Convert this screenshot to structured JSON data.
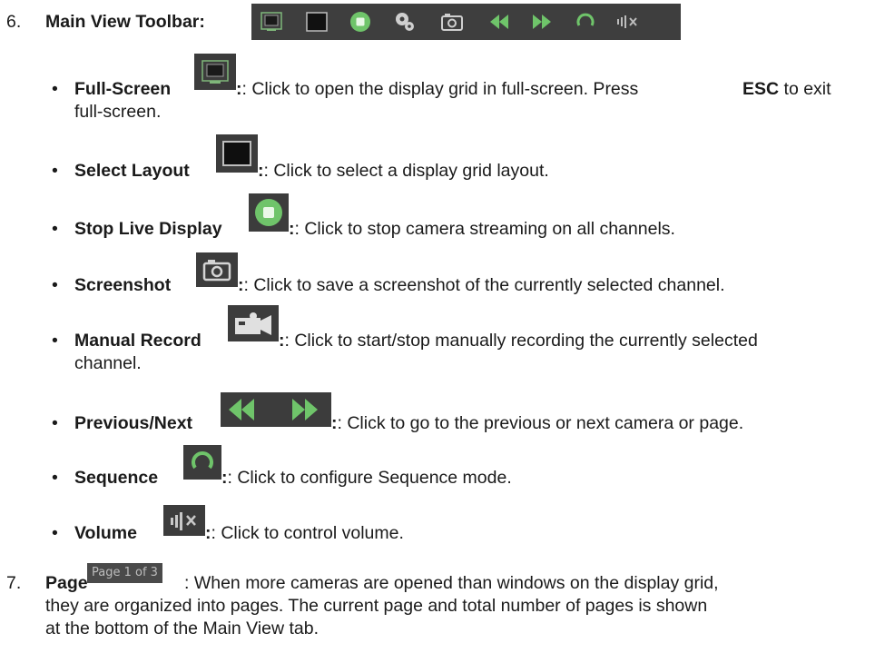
{
  "item6": {
    "number": "6.",
    "title": "Main View Toolbar:"
  },
  "toolbar_icons": [
    "fullscreen-icon",
    "layout-icon",
    "stop-live-icon",
    "record-icon",
    "screenshot-icon",
    "previous-icon",
    "next-icon",
    "sequence-icon",
    "volume-icon"
  ],
  "bullets": [
    {
      "label": "Full-Screen",
      "text": ": Click to open the display grid in full-screen. Press ",
      "key": "ESC",
      "text_after": " to exit",
      "line2": "full-screen."
    },
    {
      "label": "Select Layout",
      "text": ": Click to select a display grid layout."
    },
    {
      "label": "Stop Live Display",
      "text": ": Click to stop camera streaming on all channels."
    },
    {
      "label": "Screenshot",
      "text": ": Click to save a screenshot of the currently selected channel."
    },
    {
      "label": "Manual Record",
      "text": ": Click to start/stop manually recording the currently selected",
      "line2": "channel."
    },
    {
      "label": "Previous/Next",
      "text": ": Click to go to the previous or next camera or page."
    },
    {
      "label": "Sequence",
      "text": ": Click to configure Sequence mode."
    },
    {
      "label": "Volume",
      "text": ": Click to control volume."
    }
  ],
  "item7": {
    "number": "7.",
    "title": "Page",
    "page_indicator": "Page 1 of 3",
    "text1": ": When more cameras are opened than windows on the display grid,",
    "text2": "they are organized into pages. The current page and total number of pages is shown",
    "text3": "at the bottom of the Main View tab."
  },
  "colors": {
    "toolbar_bg": "#3e3e3e",
    "green": "#6fc46a",
    "icon_gray": "#cfcfcf"
  }
}
